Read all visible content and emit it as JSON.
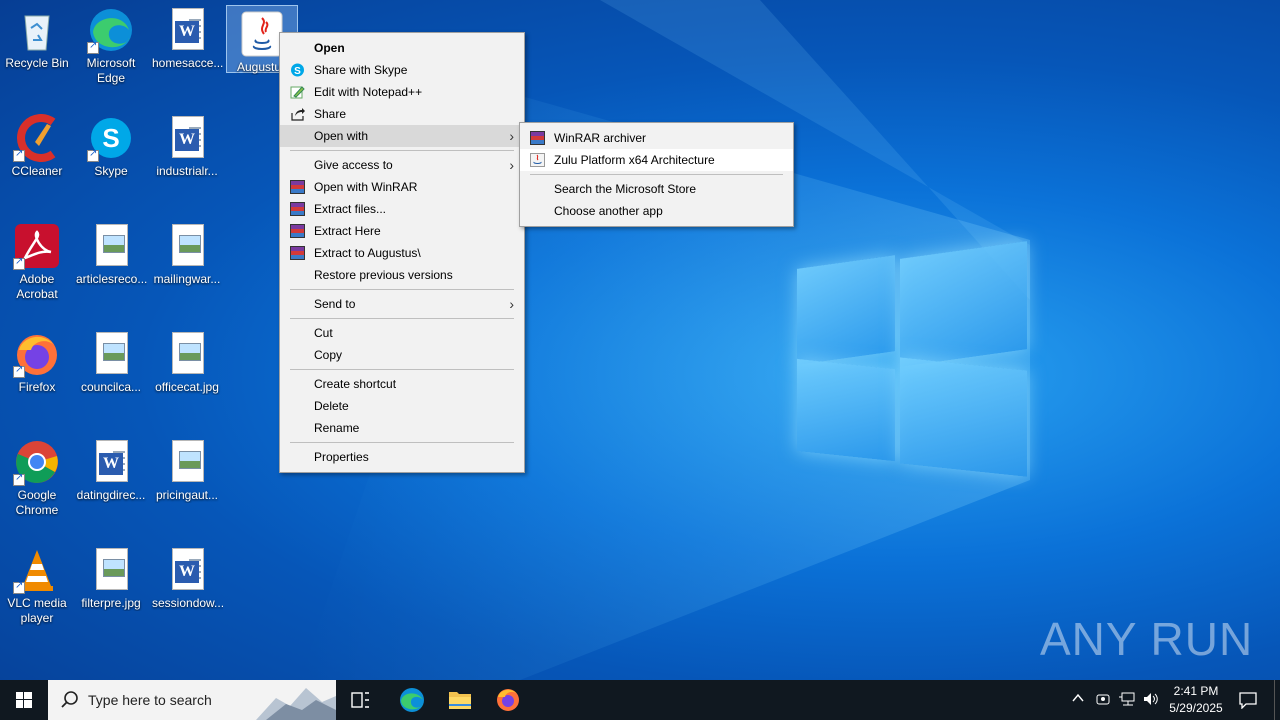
{
  "desktop_icons": [
    {
      "label": "Recycle Bin"
    },
    {
      "label": "Microsoft Edge"
    },
    {
      "label": "homesacce..."
    },
    {
      "label": "Augustus"
    },
    {
      "label": "CCleaner"
    },
    {
      "label": "Skype"
    },
    {
      "label": "industrialr..."
    },
    {
      "label": "Adobe Acrobat"
    },
    {
      "label": "articlesreco..."
    },
    {
      "label": "mailingwar..."
    },
    {
      "label": "Firefox"
    },
    {
      "label": "councilca..."
    },
    {
      "label": "officecat.jpg"
    },
    {
      "label": "Google Chrome"
    },
    {
      "label": "datingdirec..."
    },
    {
      "label": "pricingaut..."
    },
    {
      "label": "VLC media player"
    },
    {
      "label": "filterpre.jpg"
    },
    {
      "label": "sessiondow..."
    }
  ],
  "context_menu": {
    "items": [
      {
        "label": "Open",
        "icon": "none",
        "bold": true
      },
      {
        "label": "Share with Skype",
        "icon": "skype-icon"
      },
      {
        "label": "Edit with Notepad++",
        "icon": "notepadpp-icon"
      },
      {
        "label": "Share",
        "icon": "share-icon"
      },
      {
        "label": "Open with",
        "icon": "none",
        "submenu": true,
        "highlighted": true
      },
      {
        "label": "Give access to",
        "icon": "none",
        "submenu": true
      },
      {
        "label": "Open with WinRAR",
        "icon": "winrar-icon"
      },
      {
        "label": "Extract files...",
        "icon": "winrar-icon"
      },
      {
        "label": "Extract Here",
        "icon": "winrar-icon"
      },
      {
        "label": "Extract to Augustus\\",
        "icon": "winrar-icon"
      },
      {
        "label": "Restore previous versions",
        "icon": "none"
      },
      {
        "label": "Send to",
        "icon": "none",
        "submenu": true
      },
      {
        "label": "Cut",
        "icon": "none"
      },
      {
        "label": "Copy",
        "icon": "none"
      },
      {
        "label": "Create shortcut",
        "icon": "none"
      },
      {
        "label": "Delete",
        "icon": "none"
      },
      {
        "label": "Rename",
        "icon": "none"
      },
      {
        "label": "Properties",
        "icon": "none"
      }
    ]
  },
  "open_with_submenu": {
    "items": [
      {
        "label": "WinRAR archiver",
        "icon": "winrar-icon"
      },
      {
        "label": "Zulu Platform x64 Architecture",
        "icon": "java-icon",
        "highlighted": true
      },
      {
        "label": "Search the Microsoft Store",
        "icon": "none"
      },
      {
        "label": "Choose another app",
        "icon": "none"
      }
    ]
  },
  "taskbar": {
    "search_placeholder": "Type here to search",
    "clock_time": "2:41 PM",
    "clock_date": "5/29/2025"
  },
  "watermark": "ANY RUN"
}
